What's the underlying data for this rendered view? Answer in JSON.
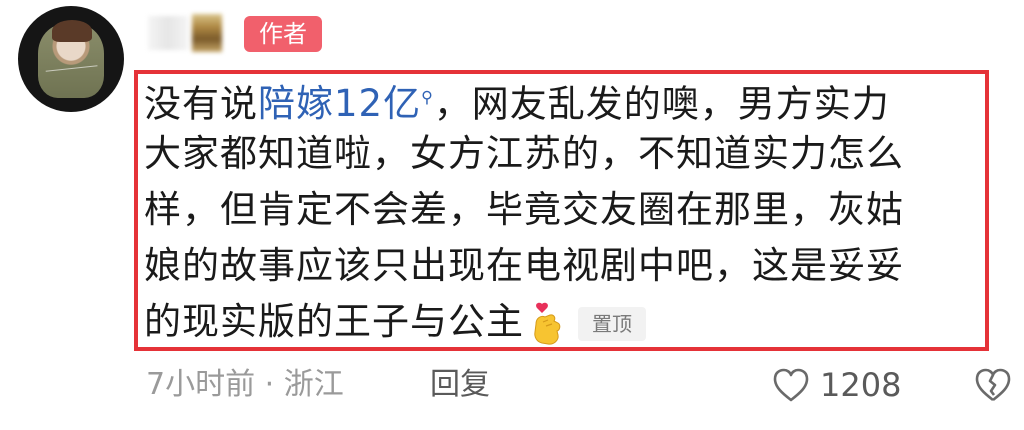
{
  "author": {
    "badge_label": "作者"
  },
  "comment": {
    "lines": [
      [
        "没有说",
        "陪嫁12亿",
        "，网友乱发的噢，男方实力"
      ],
      [
        "大家都知道啦，女方江苏的，不知道实力怎么"
      ],
      [
        "样，但肯定不会差，毕竟交友圈在那里，灰姑"
      ],
      [
        "娘的故事应该只出现在电视剧中吧，这是妥妥"
      ],
      [
        "的现实版的王子与公主"
      ]
    ],
    "link_text": "陪嫁12亿",
    "pin_label": "置顶",
    "emoji_name": "finger-heart-emoji",
    "link_color": "#2f62b5",
    "highlight_border_color": "#e53238"
  },
  "meta": {
    "time_location": "7小时前 · 浙江",
    "reply_label": "回复",
    "like_count": "1208"
  },
  "colors": {
    "badge_bg": "#f1606c",
    "meta_text": "#9a9a9a"
  }
}
